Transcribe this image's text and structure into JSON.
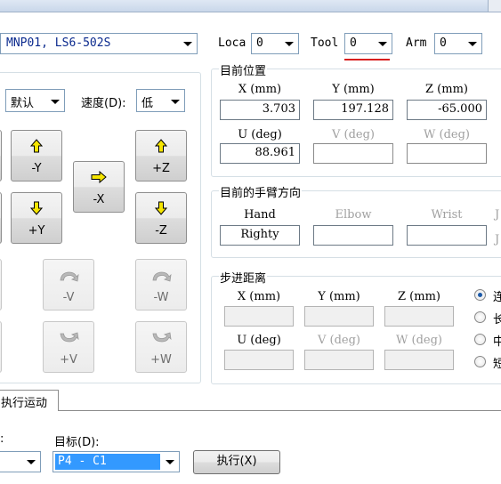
{
  "robot_combo": {
    "value": "MNP01, LS6-502S"
  },
  "top_bar": {
    "local_label": "Loca",
    "local_value": "0",
    "tool_label": "Tool",
    "tool_value": "0",
    "arm_label": "Arm",
    "arm_value": "0"
  },
  "jog_panel": {
    "mode_value": "默认",
    "speed_label": "速度(D):",
    "speed_value": "低",
    "buttons": {
      "minus_y": "-Y",
      "plus_y": "+Y",
      "minus_x": "-X",
      "plus_z": "+Z",
      "minus_z": "-Z",
      "minus_v": "-V",
      "plus_v": "+V",
      "minus_w": "-W",
      "plus_w": "+W"
    }
  },
  "current_position": {
    "title": "目前位置",
    "headers": [
      "X (mm)",
      "Y (mm)",
      "Z (mm)",
      "U (deg)",
      "V (deg)",
      "W (deg)"
    ],
    "values": [
      "3.703",
      "197.128",
      "-65.000",
      "88.961",
      "",
      ""
    ]
  },
  "arm_orientation": {
    "title": "目前的手臂方向",
    "headers": [
      "Hand",
      "Elbow",
      "Wrist"
    ],
    "values": [
      "Righty",
      "",
      ""
    ],
    "extra_1": "J",
    "extra_2": "J"
  },
  "step_distance": {
    "title": "步进距离",
    "headers": [
      "X (mm)",
      "Y (mm)",
      "Z (mm)",
      "U (deg)",
      "V (deg)",
      "W (deg)"
    ],
    "radio_labels": [
      "连",
      "长",
      "中",
      "短"
    ],
    "selected_index": 0
  },
  "execute": {
    "tab_label": "执行运动",
    "left_label": ":",
    "target_label": "目标(D):",
    "target_value": "P4 - C1",
    "execute_button": "执行(X)"
  },
  "colors": {
    "accent": "#d81e1e",
    "selection": "#3399ff",
    "arrow_yellow": "#f5e500"
  }
}
